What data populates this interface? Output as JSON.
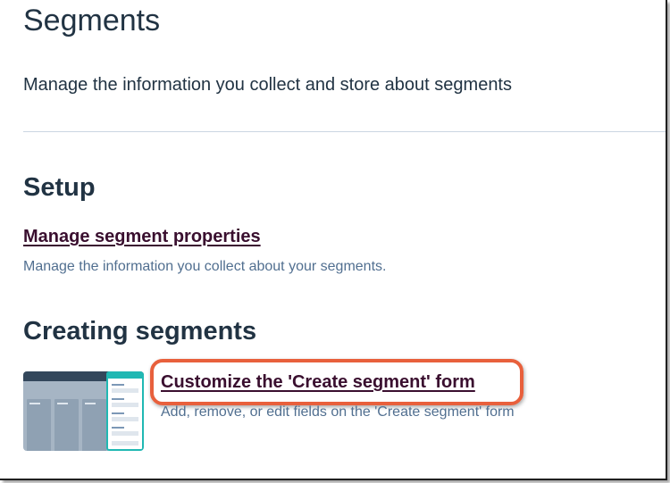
{
  "page": {
    "title": "Segments",
    "subtitle": "Manage the information you collect and store about segments"
  },
  "sections": {
    "setup": {
      "heading": "Setup",
      "link_label": "Manage segment properties",
      "description": "Manage the information you collect about your segments."
    },
    "creating": {
      "heading": "Creating segments",
      "link_label": "Customize the 'Create segment' form",
      "description": "Add, remove, or edit fields on the 'Create segment' form",
      "thumbnail_icon": "form-preview-thumbnail"
    }
  },
  "colors": {
    "link": "#3a0f2f",
    "highlight": "#e8603c",
    "text_dark": "#213343",
    "text_muted": "#516f90",
    "accent_teal": "#20b8b3"
  }
}
